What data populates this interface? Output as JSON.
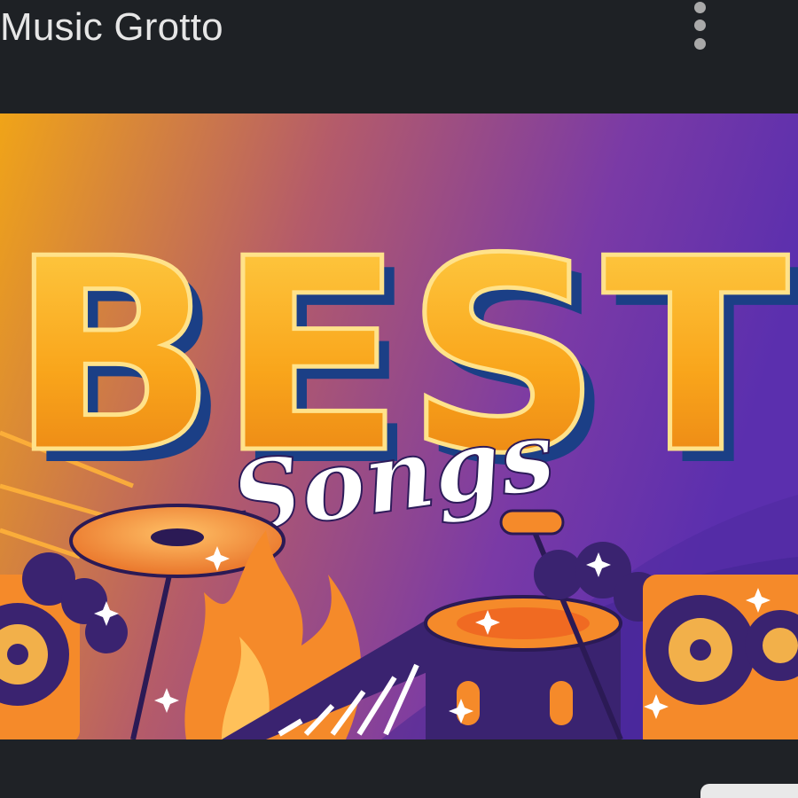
{
  "header": {
    "channel_name": "Music Grotto",
    "menu_icon": "more-vert-icon"
  },
  "banner": {
    "headline": "BEST",
    "subtitle": "Songs",
    "colors": {
      "gradient_left": "#f0a418",
      "gradient_right": "#6a2fb0",
      "letter_fill": "#f7a81c",
      "letter_shadow": "#1b3f86",
      "script_text": "#ffffff",
      "instrument_navy": "#3a2370",
      "instrument_orange": "#f58a2a"
    },
    "illustration_icons": [
      "drum-kit-icon",
      "cymbal-icon",
      "fire-icon",
      "piano-keys-icon",
      "microphone-icon",
      "speaker-icon",
      "sparkle-icon"
    ]
  }
}
